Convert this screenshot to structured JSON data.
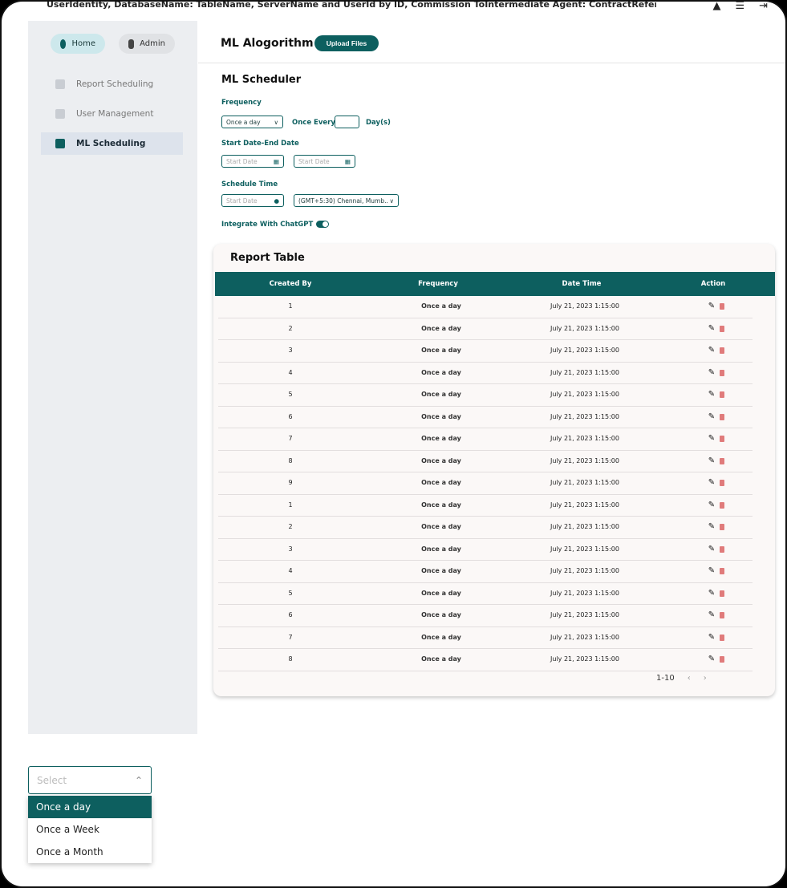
{
  "top_bar": {
    "info_text": "UserIdentity, DatabaseName: TableName, ServerName and UserId by ID, Commission ToIntermediate Agent: ContractReferenceNo and Completion Date",
    "icons": [
      "bell-icon",
      "menu-icon",
      "logout-icon"
    ]
  },
  "sidebar": {
    "home_label": "Home",
    "admin_label": "Admin",
    "items": [
      {
        "label": "Report Scheduling",
        "icon": "cart-icon"
      },
      {
        "label": "User Management",
        "icon": "document-icon"
      },
      {
        "label": "ML Scheduling",
        "icon": "chart-icon"
      }
    ]
  },
  "header": {
    "title": "ML Alogorithm",
    "upload_label": "Upload Files"
  },
  "scheduler": {
    "title": "ML Scheduler",
    "frequency_label": "Frequency",
    "frequency_value": "Once a day",
    "once_every_label": "Once Every",
    "days_label": "Day(s)",
    "date_range_label": "Start Date-End Date",
    "start_date_placeholder": "Start Date",
    "end_date_placeholder": "Start Date",
    "schedule_time_label": "Schedule Time",
    "time_placeholder": "Start Date",
    "timezone_value": "(GMT+5:30) Chennai, Mumb..",
    "chatgpt_label": "Integrate With ChatGPT",
    "chatgpt_on": true
  },
  "report_table": {
    "title": "Report Table",
    "columns": [
      "Created By",
      "Frequency",
      "Date Time",
      "Action"
    ],
    "rows": [
      {
        "created_by": "1",
        "frequency": "Once a day",
        "datetime": "July 21, 2023 1:15:00"
      },
      {
        "created_by": "2",
        "frequency": "Once a day",
        "datetime": "July 21, 2023 1:15:00"
      },
      {
        "created_by": "3",
        "frequency": "Once a day",
        "datetime": "July 21, 2023 1:15:00"
      },
      {
        "created_by": "4",
        "frequency": "Once a day",
        "datetime": "July 21, 2023 1:15:00"
      },
      {
        "created_by": "5",
        "frequency": "Once a day",
        "datetime": "July 21, 2023 1:15:00"
      },
      {
        "created_by": "6",
        "frequency": "Once a day",
        "datetime": "July 21, 2023 1:15:00"
      },
      {
        "created_by": "7",
        "frequency": "Once a day",
        "datetime": "July 21, 2023 1:15:00"
      },
      {
        "created_by": "8",
        "frequency": "Once a day",
        "datetime": "July 21, 2023 1:15:00"
      },
      {
        "created_by": "9",
        "frequency": "Once a day",
        "datetime": "July 21, 2023 1:15:00"
      },
      {
        "created_by": "1",
        "frequency": "Once a day",
        "datetime": "July 21, 2023 1:15:00"
      },
      {
        "created_by": "2",
        "frequency": "Once a day",
        "datetime": "July 21, 2023 1:15:00"
      },
      {
        "created_by": "3",
        "frequency": "Once a day",
        "datetime": "July 21, 2023 1:15:00"
      },
      {
        "created_by": "4",
        "frequency": "Once a day",
        "datetime": "July 21, 2023 1:15:00"
      },
      {
        "created_by": "5",
        "frequency": "Once a day",
        "datetime": "July 21, 2023 1:15:00"
      },
      {
        "created_by": "6",
        "frequency": "Once a day",
        "datetime": "July 21, 2023 1:15:00"
      },
      {
        "created_by": "7",
        "frequency": "Once a day",
        "datetime": "July 21, 2023 1:15:00"
      },
      {
        "created_by": "8",
        "frequency": "Once a day",
        "datetime": "July 21, 2023 1:15:00"
      }
    ],
    "pagination": {
      "range": "1-10",
      "prev": "‹",
      "next": "›"
    }
  },
  "dropdown": {
    "placeholder": "Select",
    "options": [
      "Once a day",
      "Once a Week",
      "Once a Month"
    ],
    "selected_index": 0
  },
  "colors": {
    "primary": "#0d5f5f",
    "sidebar_bg": "#eceef1",
    "delete": "#e07b7b"
  }
}
